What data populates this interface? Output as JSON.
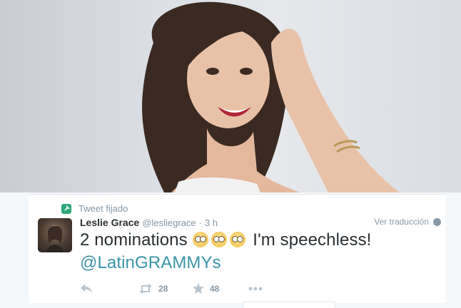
{
  "header": {
    "photo_icon": "portrait-photo"
  },
  "tweet": {
    "pinned_label": "Tweet fijado",
    "pin_icon": "pin-icon",
    "display_name": "Leslie Grace",
    "handle": "@lesliegrace",
    "separator": "·",
    "time": "3 h",
    "translate_label": "Ver traducción",
    "text_part1": "2 nominations",
    "text_part2": "I'm speechless!",
    "mention": "@LatinGRAMMYs",
    "emoji_icon": "flushed-face-icon",
    "actions": {
      "reply_icon": "reply-icon",
      "retweet_icon": "retweet-icon",
      "retweet_count": "28",
      "favorite_icon": "star-icon",
      "favorite_count": "48",
      "more_icon": "more-icon"
    }
  },
  "colors": {
    "background": "#f5f8fa",
    "text": "#292f33",
    "muted": "#8899a6",
    "mention": "#3b94a8",
    "pin": "#2fa67a"
  }
}
